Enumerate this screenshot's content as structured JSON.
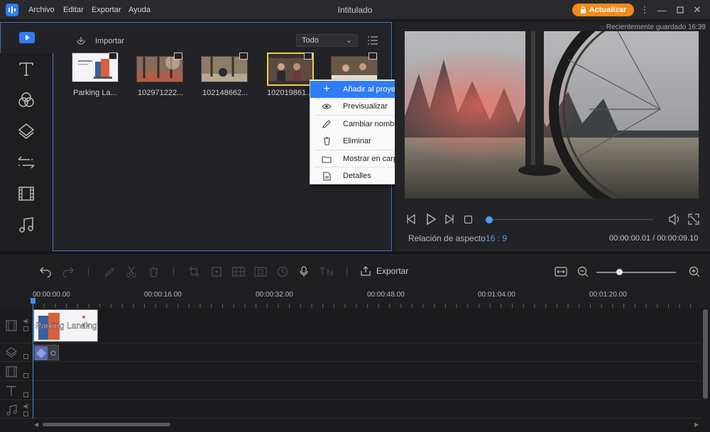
{
  "window": {
    "title": "Intitulado",
    "menus": [
      "Archivo",
      "Editar",
      "Exportar",
      "Ayuda"
    ],
    "upgrade_label": "Actualizar"
  },
  "media": {
    "import_label": "Importar",
    "filter_selected": "Todo",
    "items": [
      {
        "label": "Parking La..."
      },
      {
        "label": "102971222..."
      },
      {
        "label": "102148662..."
      },
      {
        "label": "102019861..."
      },
      {
        "label": ""
      }
    ]
  },
  "context_menu": {
    "items": [
      "Añadir al proyecto",
      "Previsualizar",
      "Cambiar nombre",
      "Eliminar",
      "Mostrar en carpeta",
      "Detalles"
    ]
  },
  "preview": {
    "saved_note": "Recientemente guardado 16:39",
    "aspect_label": "Relación de aspecto",
    "aspect_value": "16 : 9",
    "time_current": "00:00:00.01",
    "time_separator": " / ",
    "time_total": "00:00:09.10"
  },
  "toolbar": {
    "export_label": "Exportar"
  },
  "ruler": {
    "ticks": [
      "00:00:00.00",
      "00:00:16.00",
      "00:00:32.00",
      "00:00:48.00",
      "00:01:04.00",
      "00:01:20.00"
    ]
  },
  "timeline": {
    "clip_title": "Parking Landing"
  },
  "colors": {
    "accent": "#2f7cf6",
    "upgrade": "#f28b1a",
    "selection": "#e8d24a",
    "panel_border": "#4a72b8"
  }
}
